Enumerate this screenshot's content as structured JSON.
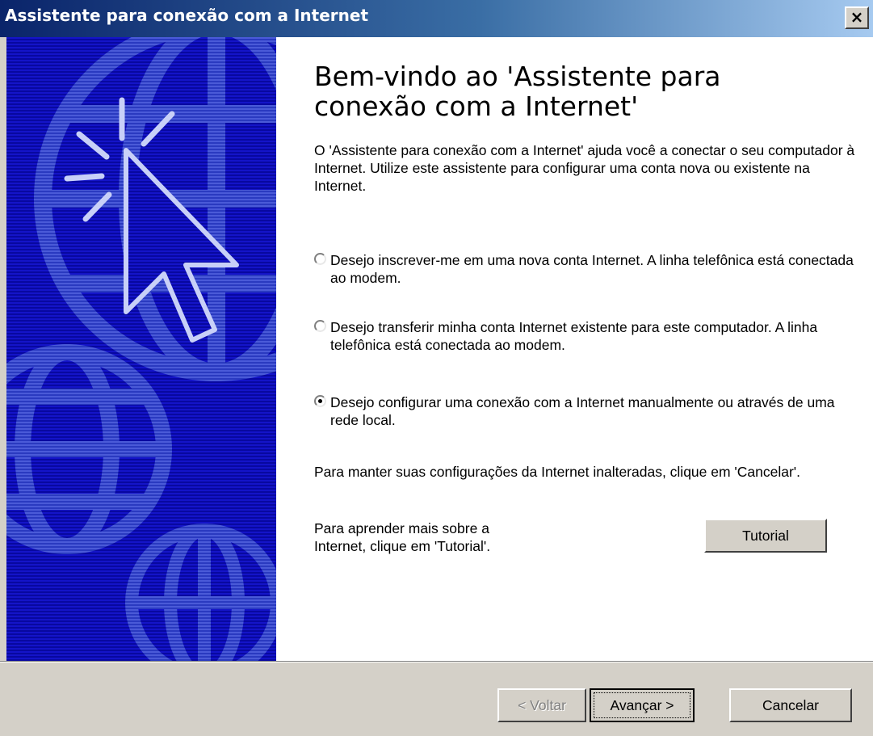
{
  "window": {
    "title": "Assistente para conexão com a Internet",
    "close_label": "×"
  },
  "content": {
    "heading": "Bem-vindo ao 'Assistente para conexão com a Internet'",
    "intro": "O 'Assistente para conexão com a Internet' ajuda você a conectar o seu computador à Internet.  Utilize este assistente para configurar uma conta nova ou existente na Internet.",
    "options": [
      {
        "label": "Desejo inscrever-me em uma nova conta Internet. A linha telefônica está conectada ao modem.",
        "selected": false
      },
      {
        "label": "Desejo transferir minha conta Internet existente para este computador. A linha telefônica está conectada ao modem.",
        "selected": false
      },
      {
        "label": "Desejo configurar uma conexão com a Internet manualmente ou através de uma rede local.",
        "selected": true
      }
    ],
    "cancel_note": "Para manter suas configurações da Internet inalteradas, clique em 'Cancelar'.",
    "tutorial_note": "Para aprender mais sobre a Internet, clique em 'Tutorial'.",
    "tutorial_button": "Tutorial"
  },
  "footer": {
    "back_button": "< Voltar",
    "next_button": "Avançar >",
    "cancel_button": "Cancelar"
  },
  "colors": {
    "titlebar_start": "#0a246a",
    "banner": "#0a0ab0",
    "dialog": "#d4d0c8"
  },
  "icons": [
    "globe-graphic",
    "cursor-arrow-graphic",
    "close-icon"
  ]
}
